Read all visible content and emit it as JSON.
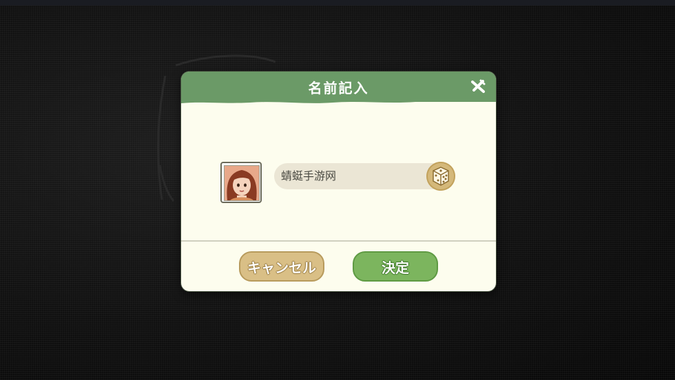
{
  "dialog": {
    "title": "名前記入",
    "close_icon": "close-x-icon"
  },
  "player": {
    "avatar_icon": "girl-portrait-icon",
    "name_value": "蜻蜓手游网",
    "random_icon": "dice-icon"
  },
  "buttons": {
    "cancel_label": "キャンセル",
    "confirm_label": "決定"
  },
  "colors": {
    "header_green": "#6b9a67",
    "panel_cream": "#fdfdee",
    "cancel_tan": "#d9bf86",
    "confirm_green": "#7cb55e"
  }
}
